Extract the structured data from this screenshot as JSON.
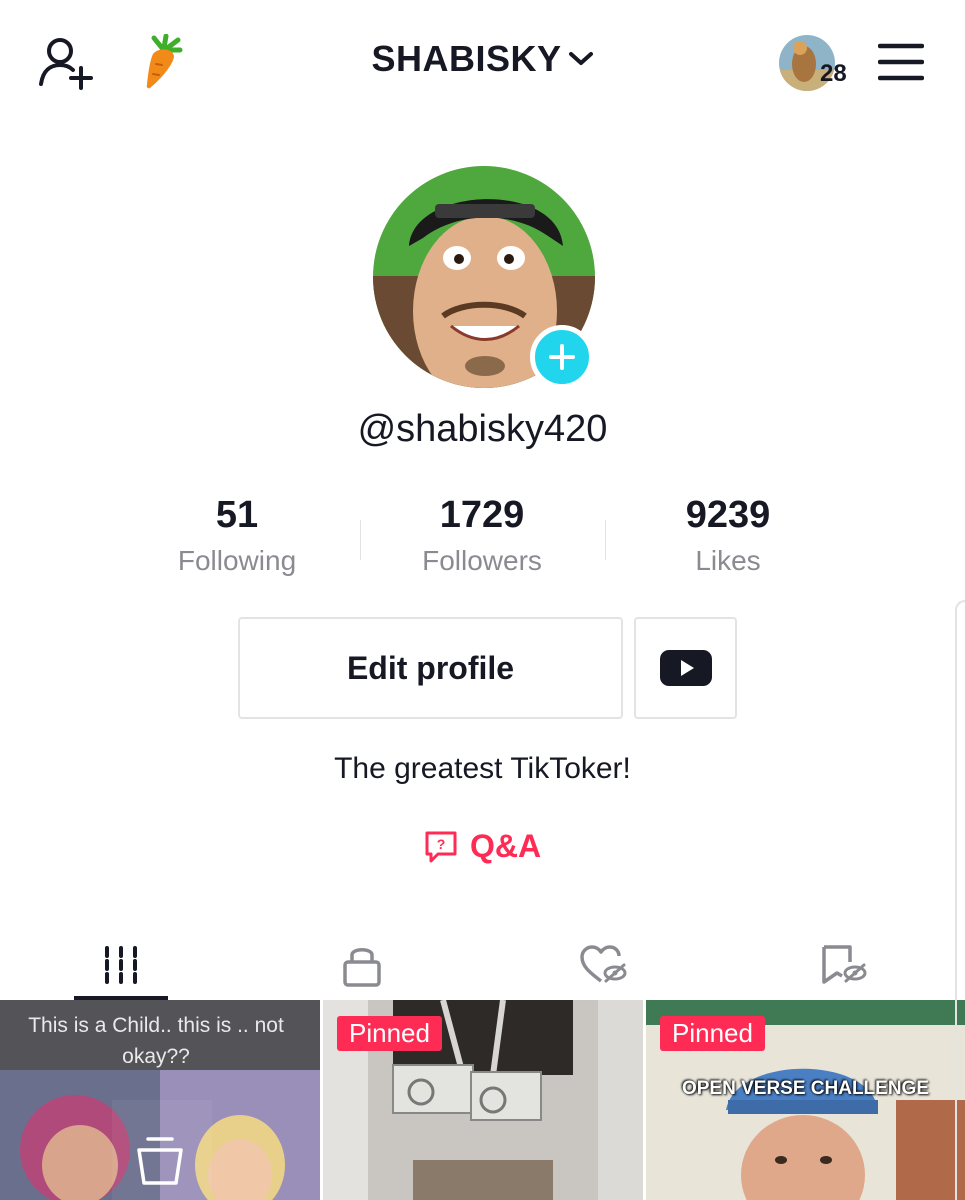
{
  "header": {
    "title": "SHABISKY",
    "notification_count": "28",
    "icons": {
      "add_friend": "person-plus-icon",
      "carrot": "carrot-icon",
      "chevron": "chevron-down-icon",
      "menu": "hamburger-menu-icon"
    }
  },
  "profile": {
    "username": "@shabisky420",
    "bio": "The greatest TikToker!",
    "qa_label": "Q&A"
  },
  "stats": [
    {
      "value": "51",
      "label": "Following"
    },
    {
      "value": "1729",
      "label": "Followers"
    },
    {
      "value": "9239",
      "label": "Likes"
    }
  ],
  "buttons": {
    "edit_profile": "Edit profile"
  },
  "tabs": [
    {
      "icon": "grid-icon"
    },
    {
      "icon": "lock-icon"
    },
    {
      "icon": "liked-hidden-icon"
    },
    {
      "icon": "bookmark-hidden-icon"
    }
  ],
  "videos": [
    {
      "caption": "This is a Child.. this is .. not okay??",
      "pinned": ""
    },
    {
      "caption": "",
      "pinned": "Pinned"
    },
    {
      "caption": "OPEN VERSE CHALLENGE",
      "pinned": "Pinned"
    }
  ],
  "colors": {
    "accent": "#fe2c55",
    "badge": "#20d5ec",
    "text": "#161823",
    "muted": "#8a8b91"
  }
}
